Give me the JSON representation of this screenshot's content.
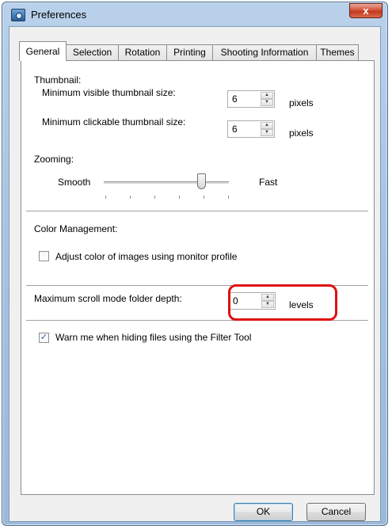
{
  "window": {
    "title": "Preferences",
    "close_label": "x"
  },
  "tabs": [
    {
      "label": "General"
    },
    {
      "label": "Selection"
    },
    {
      "label": "Rotation"
    },
    {
      "label": "Printing"
    },
    {
      "label": "Shooting Information"
    },
    {
      "label": "Themes"
    }
  ],
  "thumbnail": {
    "heading": "Thumbnail:",
    "min_visible_label": "Minimum visible thumbnail size:",
    "min_visible_value": "6",
    "min_clickable_label": "Minimum clickable thumbnail size:",
    "min_clickable_value": "6",
    "unit": "pixels"
  },
  "zooming": {
    "heading": "Zooming:",
    "left_label": "Smooth",
    "right_label": "Fast",
    "level": 0.78
  },
  "color_management": {
    "heading": "Color Management:",
    "checkbox_label": "Adjust color of images using monitor profile",
    "checked": false
  },
  "scroll": {
    "label": "Maximum scroll mode folder depth:",
    "value": "0",
    "unit": "levels"
  },
  "filter_warning": {
    "checkbox_label": "Warn me when hiding files using the Filter Tool",
    "checked": true
  },
  "buttons": {
    "ok": "OK",
    "cancel": "Cancel"
  },
  "icons": {
    "app": "preferences-app-icon",
    "close": "close-icon",
    "up": "spin-up-icon",
    "down": "spin-down-icon",
    "check": "checkmark-icon"
  },
  "colors": {
    "highlight": "#e01010",
    "title_bar": "#a9c4e2",
    "close_button": "#c13a1f"
  }
}
